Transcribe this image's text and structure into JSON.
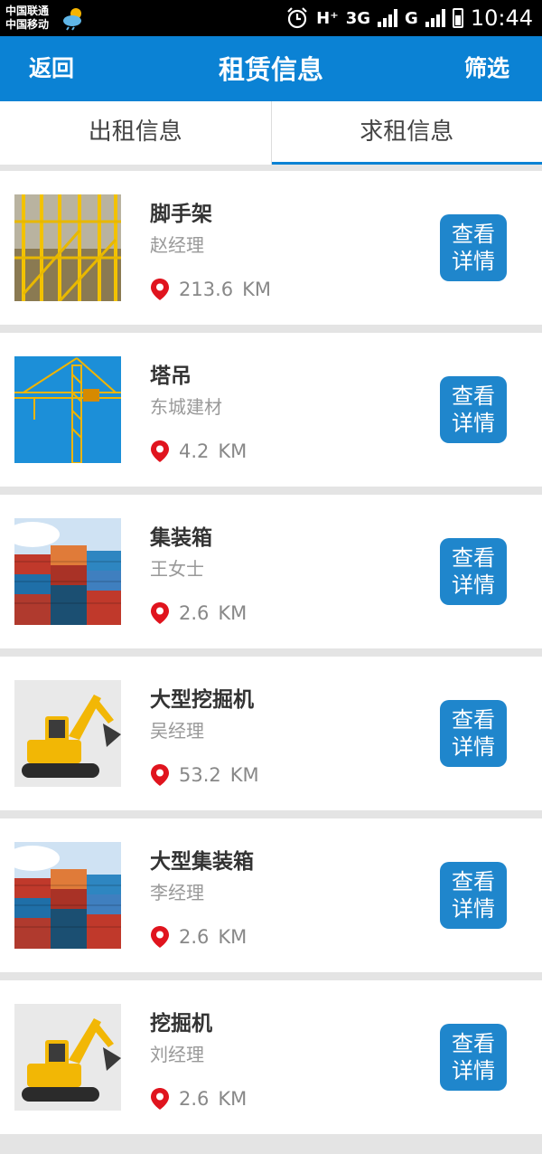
{
  "status_bar": {
    "carrier_1": "中国联通",
    "carrier_2": "中国移动",
    "network_1": "3G",
    "network_2": "G",
    "time": "10:44"
  },
  "navbar": {
    "back_label": "返回",
    "title": "租赁信息",
    "filter_label": "筛选",
    "color": "#0b82d4"
  },
  "tabs": [
    {
      "label": "出租信息",
      "active": false
    },
    {
      "label": "求租信息",
      "active": true
    }
  ],
  "listings": [
    {
      "title": "脚手架",
      "contact": "赵经理",
      "distance": "213.6",
      "unit": "KM",
      "button": "查看\n详情",
      "image": "scaffold"
    },
    {
      "title": "塔吊",
      "contact": "东城建材",
      "distance": "4.2",
      "unit": "KM",
      "button": "查看\n详情",
      "image": "tower-crane"
    },
    {
      "title": "集装箱",
      "contact": "王女士",
      "distance": "2.6",
      "unit": "KM",
      "button": "查看\n详情",
      "image": "containers"
    },
    {
      "title": "大型挖掘机",
      "contact": "吴经理",
      "distance": "53.2",
      "unit": "KM",
      "button": "查看\n详情",
      "image": "excavator"
    },
    {
      "title": "大型集装箱",
      "contact": "李经理",
      "distance": "2.6",
      "unit": "KM",
      "button": "查看\n详情",
      "image": "containers"
    },
    {
      "title": "挖掘机",
      "contact": "刘经理",
      "distance": "2.6",
      "unit": "KM",
      "button": "查看\n详情",
      "image": "excavator"
    }
  ]
}
